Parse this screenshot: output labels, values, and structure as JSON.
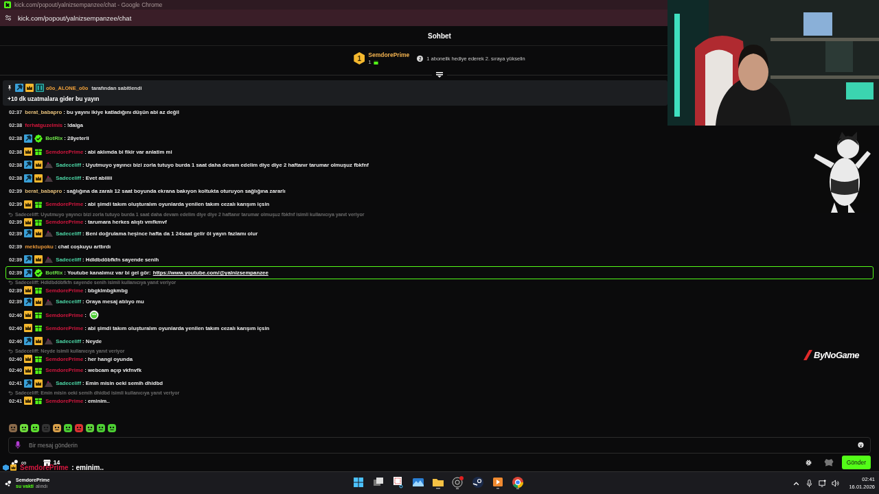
{
  "browser": {
    "title": "kick.com/popout/yalnizsempanzee/chat - Google Chrome",
    "url": "kick.com/popout/yalnizsempanzee/chat"
  },
  "chat": {
    "title": "Sohbet",
    "leaderboard": {
      "rank": "1",
      "user": "SemdorePrime",
      "gifts": "1",
      "next_rank": "2",
      "hint": "1 abonelik hediye ederek 2. sıraya yükselin"
    },
    "pinned": {
      "badges": [
        {
          "kind": "moderator"
        },
        {
          "kind": "vip"
        },
        {
          "kind": "og"
        }
      ],
      "user": "o0o_ALONE_o0o",
      "by": "tarafından sabitlendi",
      "text": "+10 dk uzatmalara gider bu yayın"
    },
    "messages": [
      {
        "time": "02:37",
        "user": "berat_babapro",
        "color": "#e6c07b",
        "text": ": bu yayını ikiye katladığını düşün abi az değil",
        "highlighted": false
      },
      {
        "time": "02:38",
        "user": "ferhatguzelmis",
        "color": "#d6173d",
        "text": ": !dalga",
        "highlighted": false
      },
      {
        "time": "02:38",
        "user": "BotRix",
        "color": "#6ee34a",
        "badges": [
          {
            "kind": "moderator"
          },
          {
            "kind": "verified"
          }
        ],
        "text": ": 28yeterli",
        "highlighted": false
      },
      {
        "time": "02:38",
        "user": "SemdorePrime",
        "color": "#d3173f",
        "badges": [
          {
            "kind": "vip"
          },
          {
            "kind": "sub"
          }
        ],
        "text": ": abi aklımda bi fikir var anlatim mi",
        "highlighted": false
      },
      {
        "time": "02:38",
        "user": "Sadeceliff",
        "color": "#4cd4a4",
        "badges": [
          {
            "kind": "moderator"
          },
          {
            "kind": "vip"
          },
          {
            "kind": "hill"
          }
        ],
        "text": ": Uyutmuyo yayıncı bizi zorla tutuyo burda 1 saat daha devam edelim diye diye 2 haftanır tarumar olmuşuz fbkfnf",
        "highlighted": false
      },
      {
        "time": "02:38",
        "user": "Sadeceliff",
        "color": "#4cd4a4",
        "badges": [
          {
            "kind": "moderator"
          },
          {
            "kind": "vip"
          },
          {
            "kind": "hill"
          }
        ],
        "text": ": Evet abiiiii",
        "highlighted": false
      },
      {
        "time": "02:39",
        "user": "berat_babapro",
        "color": "#e6c07b",
        "text": ": sağlığına da zaralı 12 saat boyunda ekrana bakıyon koltukta oturuyon sağlığına zararlı",
        "highlighted": false
      },
      {
        "time": "02:39",
        "user": "SemdorePrime",
        "color": "#d3173f",
        "badges": [
          {
            "kind": "vip"
          },
          {
            "kind": "sub"
          }
        ],
        "text": ": abi şimdi takım oluşturalım oyunlarda yenilen takım cezalı karışım içsin",
        "highlighted": false
      },
      {
        "reply": "Sadeceliff: Uyutmuyo yayıncı bizi zorla tutuyo burda 1 saat daha devam edelim diye diye 2 haftanır tarumar olmuşuz fbkfnf isimli kullanıcıya yanıt veriyor",
        "time": "02:39",
        "user": "SemdorePrime",
        "color": "#d3173f",
        "badges": [
          {
            "kind": "vip"
          },
          {
            "kind": "sub"
          }
        ],
        "text": ": tarumara herkes alıştı vmfkmvf",
        "highlighted": false
      },
      {
        "time": "02:39",
        "user": "Sadeceliff",
        "color": "#4cd4a4",
        "badges": [
          {
            "kind": "moderator"
          },
          {
            "kind": "vip"
          },
          {
            "kind": "hill"
          }
        ],
        "text": ": Beni doğrulama heşince hafta da 1 24saat gelir öi yayın fazlamı olur",
        "highlighted": false
      },
      {
        "time": "02:39",
        "user": "mektupoku",
        "color": "#e8973a",
        "text": ": chat coşkuyu arttırdı",
        "highlighted": false
      },
      {
        "time": "02:39",
        "user": "Sadeceliff",
        "color": "#4cd4a4",
        "badges": [
          {
            "kind": "moderator"
          },
          {
            "kind": "vip"
          },
          {
            "kind": "hill"
          }
        ],
        "text": ": Hdldbdöbfkfn sayende senih",
        "highlighted": false
      },
      {
        "time": "02:39",
        "user": "BotRix",
        "color": "#6ee34a",
        "badges": [
          {
            "kind": "moderator"
          },
          {
            "kind": "verified"
          }
        ],
        "text": ": Youtube kanalımız var bi gel gör: ",
        "link": "https://www.youtube.com/@yalnizsempanzee",
        "highlighted": true
      },
      {
        "reply": "Sadeceliff: Hdldbdöbfkfn sayende senih isimli kullanıcıya yanıt veriyor",
        "time": "02:39",
        "user": "SemdorePrime",
        "color": "#d3173f",
        "badges": [
          {
            "kind": "vip"
          },
          {
            "kind": "sub"
          }
        ],
        "text": ": bbgklmbgkmbg",
        "highlighted": false
      },
      {
        "time": "02:39",
        "user": "Sadeceliff",
        "color": "#4cd4a4",
        "badges": [
          {
            "kind": "moderator"
          },
          {
            "kind": "vip"
          },
          {
            "kind": "hill"
          }
        ],
        "text": ": Oraya mesaj atılıyo mu",
        "highlighted": false
      },
      {
        "time": "02:40",
        "user": "SemdorePrime",
        "color": "#d3173f",
        "badges": [
          {
            "kind": "vip"
          },
          {
            "kind": "sub"
          }
        ],
        "text": ":",
        "emote": true,
        "highlighted": false
      },
      {
        "time": "02:40",
        "user": "SemdorePrime",
        "color": "#d3173f",
        "badges": [
          {
            "kind": "vip"
          },
          {
            "kind": "sub"
          }
        ],
        "text": ": abi şimdi takım oluşturalım oyunlarda yenilen takım cezalı karışım içsin",
        "highlighted": false
      },
      {
        "time": "02:40",
        "user": "Sadeceliff",
        "color": "#4cd4a4",
        "badges": [
          {
            "kind": "moderator"
          },
          {
            "kind": "vip"
          },
          {
            "kind": "hill"
          }
        ],
        "text": ": Neyde",
        "highlighted": false
      },
      {
        "reply": "Sadeceliff: Neyde isimli kullanıcıya yanıt veriyor",
        "time": "02:40",
        "user": "SemdorePrime",
        "color": "#d3173f",
        "badges": [
          {
            "kind": "vip"
          },
          {
            "kind": "sub"
          }
        ],
        "text": ": her hangi oyunda",
        "highlighted": false
      },
      {
        "time": "02:40",
        "user": "SemdorePrime",
        "color": "#d3173f",
        "badges": [
          {
            "kind": "vip"
          },
          {
            "kind": "sub"
          }
        ],
        "text": ": webcam açıp vkfnvfk",
        "highlighted": false
      },
      {
        "time": "02:41",
        "user": "Sadeceliff",
        "color": "#4cd4a4",
        "badges": [
          {
            "kind": "moderator"
          },
          {
            "kind": "vip"
          },
          {
            "kind": "hill"
          }
        ],
        "text": ": Emin misin oeki semih dhidbd",
        "highlighted": false
      },
      {
        "reply": "Sadeceliff: Emin misin oeki semih dhidbd isimli kullanıcıya yanıt veriyor",
        "time": "02:41",
        "user": "SemdorePrime",
        "color": "#d3173f",
        "badges": [
          {
            "kind": "vip"
          },
          {
            "kind": "sub"
          }
        ],
        "text": ": eminim..",
        "highlighted": false
      }
    ],
    "input": {
      "placeholder": "Bir mesaj gönderin"
    },
    "points": "∞",
    "store_count": "14",
    "send": "Gönder"
  },
  "overlay": {
    "user": "SemdorePrime",
    "text": " : eminim..",
    "logo": "ByNoGame"
  },
  "taskbar": {
    "user": "SemdorePrime",
    "status_1": "su vakti",
    "status_2": "alındı",
    "time": "02:41",
    "date": "16.01.2026"
  }
}
